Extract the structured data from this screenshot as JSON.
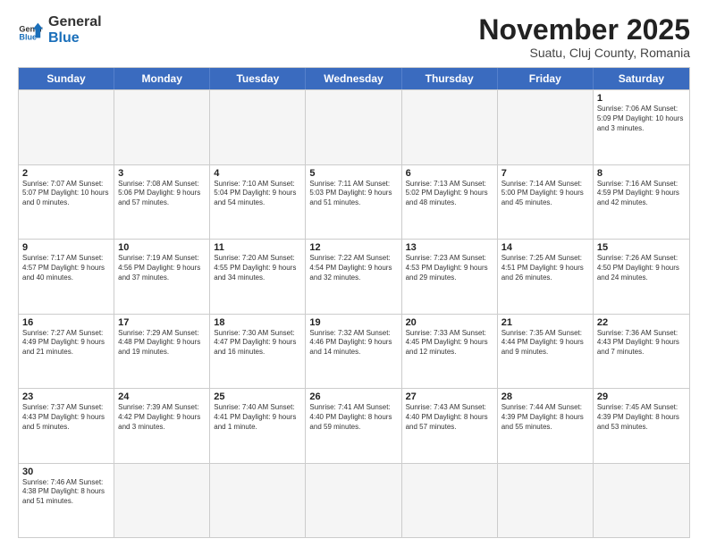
{
  "header": {
    "logo_general": "General",
    "logo_blue": "Blue",
    "month_title": "November 2025",
    "subtitle": "Suatu, Cluj County, Romania"
  },
  "weekdays": [
    "Sunday",
    "Monday",
    "Tuesday",
    "Wednesday",
    "Thursday",
    "Friday",
    "Saturday"
  ],
  "rows": [
    [
      {
        "date": "",
        "info": "",
        "empty": true
      },
      {
        "date": "",
        "info": "",
        "empty": true
      },
      {
        "date": "",
        "info": "",
        "empty": true
      },
      {
        "date": "",
        "info": "",
        "empty": true
      },
      {
        "date": "",
        "info": "",
        "empty": true
      },
      {
        "date": "",
        "info": "",
        "empty": true
      },
      {
        "date": "1",
        "info": "Sunrise: 7:06 AM\nSunset: 5:09 PM\nDaylight: 10 hours\nand 3 minutes."
      }
    ],
    [
      {
        "date": "2",
        "info": "Sunrise: 7:07 AM\nSunset: 5:07 PM\nDaylight: 10 hours\nand 0 minutes."
      },
      {
        "date": "3",
        "info": "Sunrise: 7:08 AM\nSunset: 5:06 PM\nDaylight: 9 hours\nand 57 minutes."
      },
      {
        "date": "4",
        "info": "Sunrise: 7:10 AM\nSunset: 5:04 PM\nDaylight: 9 hours\nand 54 minutes."
      },
      {
        "date": "5",
        "info": "Sunrise: 7:11 AM\nSunset: 5:03 PM\nDaylight: 9 hours\nand 51 minutes."
      },
      {
        "date": "6",
        "info": "Sunrise: 7:13 AM\nSunset: 5:02 PM\nDaylight: 9 hours\nand 48 minutes."
      },
      {
        "date": "7",
        "info": "Sunrise: 7:14 AM\nSunset: 5:00 PM\nDaylight: 9 hours\nand 45 minutes."
      },
      {
        "date": "8",
        "info": "Sunrise: 7:16 AM\nSunset: 4:59 PM\nDaylight: 9 hours\nand 42 minutes."
      }
    ],
    [
      {
        "date": "9",
        "info": "Sunrise: 7:17 AM\nSunset: 4:57 PM\nDaylight: 9 hours\nand 40 minutes."
      },
      {
        "date": "10",
        "info": "Sunrise: 7:19 AM\nSunset: 4:56 PM\nDaylight: 9 hours\nand 37 minutes."
      },
      {
        "date": "11",
        "info": "Sunrise: 7:20 AM\nSunset: 4:55 PM\nDaylight: 9 hours\nand 34 minutes."
      },
      {
        "date": "12",
        "info": "Sunrise: 7:22 AM\nSunset: 4:54 PM\nDaylight: 9 hours\nand 32 minutes."
      },
      {
        "date": "13",
        "info": "Sunrise: 7:23 AM\nSunset: 4:53 PM\nDaylight: 9 hours\nand 29 minutes."
      },
      {
        "date": "14",
        "info": "Sunrise: 7:25 AM\nSunset: 4:51 PM\nDaylight: 9 hours\nand 26 minutes."
      },
      {
        "date": "15",
        "info": "Sunrise: 7:26 AM\nSunset: 4:50 PM\nDaylight: 9 hours\nand 24 minutes."
      }
    ],
    [
      {
        "date": "16",
        "info": "Sunrise: 7:27 AM\nSunset: 4:49 PM\nDaylight: 9 hours\nand 21 minutes."
      },
      {
        "date": "17",
        "info": "Sunrise: 7:29 AM\nSunset: 4:48 PM\nDaylight: 9 hours\nand 19 minutes."
      },
      {
        "date": "18",
        "info": "Sunrise: 7:30 AM\nSunset: 4:47 PM\nDaylight: 9 hours\nand 16 minutes."
      },
      {
        "date": "19",
        "info": "Sunrise: 7:32 AM\nSunset: 4:46 PM\nDaylight: 9 hours\nand 14 minutes."
      },
      {
        "date": "20",
        "info": "Sunrise: 7:33 AM\nSunset: 4:45 PM\nDaylight: 9 hours\nand 12 minutes."
      },
      {
        "date": "21",
        "info": "Sunrise: 7:35 AM\nSunset: 4:44 PM\nDaylight: 9 hours\nand 9 minutes."
      },
      {
        "date": "22",
        "info": "Sunrise: 7:36 AM\nSunset: 4:43 PM\nDaylight: 9 hours\nand 7 minutes."
      }
    ],
    [
      {
        "date": "23",
        "info": "Sunrise: 7:37 AM\nSunset: 4:43 PM\nDaylight: 9 hours\nand 5 minutes."
      },
      {
        "date": "24",
        "info": "Sunrise: 7:39 AM\nSunset: 4:42 PM\nDaylight: 9 hours\nand 3 minutes."
      },
      {
        "date": "25",
        "info": "Sunrise: 7:40 AM\nSunset: 4:41 PM\nDaylight: 9 hours\nand 1 minute."
      },
      {
        "date": "26",
        "info": "Sunrise: 7:41 AM\nSunset: 4:40 PM\nDaylight: 8 hours\nand 59 minutes."
      },
      {
        "date": "27",
        "info": "Sunrise: 7:43 AM\nSunset: 4:40 PM\nDaylight: 8 hours\nand 57 minutes."
      },
      {
        "date": "28",
        "info": "Sunrise: 7:44 AM\nSunset: 4:39 PM\nDaylight: 8 hours\nand 55 minutes."
      },
      {
        "date": "29",
        "info": "Sunrise: 7:45 AM\nSunset: 4:39 PM\nDaylight: 8 hours\nand 53 minutes."
      }
    ],
    [
      {
        "date": "30",
        "info": "Sunrise: 7:46 AM\nSunset: 4:38 PM\nDaylight: 8 hours\nand 51 minutes."
      },
      {
        "date": "",
        "info": "",
        "empty": true
      },
      {
        "date": "",
        "info": "",
        "empty": true
      },
      {
        "date": "",
        "info": "",
        "empty": true
      },
      {
        "date": "",
        "info": "",
        "empty": true
      },
      {
        "date": "",
        "info": "",
        "empty": true
      },
      {
        "date": "",
        "info": "",
        "empty": true
      }
    ]
  ]
}
